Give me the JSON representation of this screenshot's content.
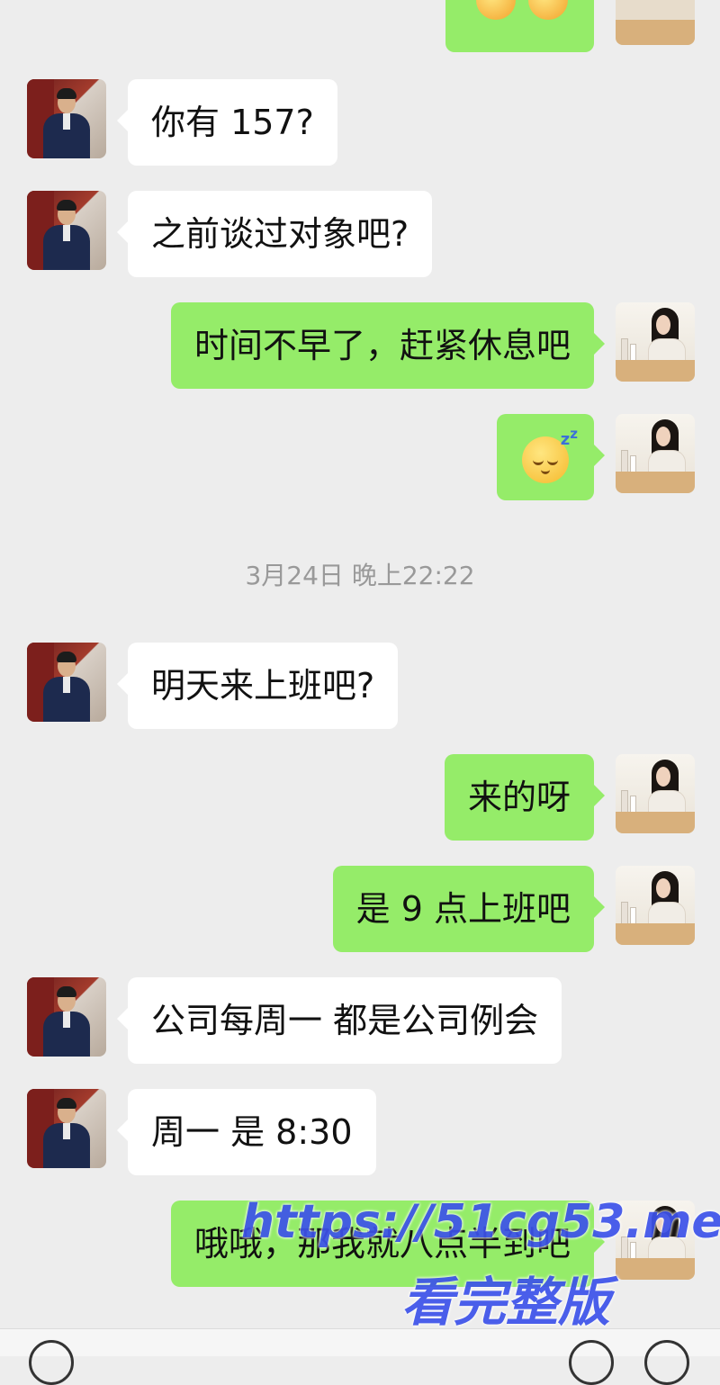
{
  "colors": {
    "background": "#ededed",
    "sent_bubble": "#95ec69",
    "received_bubble": "#ffffff",
    "timestamp": "#999999",
    "watermark": "#3d52ea"
  },
  "messages": [
    {
      "side": "left",
      "avatar": "boss",
      "text": "你有 157?"
    },
    {
      "side": "left",
      "avatar": "boss",
      "text": "之前谈过对象吧?"
    },
    {
      "side": "right",
      "avatar": "girl",
      "text": "时间不早了，赶紧休息吧"
    },
    {
      "side": "right",
      "avatar": "girl",
      "emoji": "sleeping-face-icon"
    },
    {
      "side": "left",
      "avatar": "boss",
      "text": "明天来上班吧?"
    },
    {
      "side": "right",
      "avatar": "girl",
      "text": "来的呀"
    },
    {
      "side": "right",
      "avatar": "girl",
      "text": "是 9 点上班吧"
    },
    {
      "side": "left",
      "avatar": "boss",
      "text": "公司每周一 都是公司例会"
    },
    {
      "side": "left",
      "avatar": "boss",
      "text": "周一 是 8:30"
    },
    {
      "side": "right",
      "avatar": "girl",
      "text": "哦哦，那我就八点半到吧"
    }
  ],
  "timestamp": "3月24日 晚上22:22",
  "watermark": {
    "line1": "https://51cg53.me",
    "line2": "看完整版"
  }
}
